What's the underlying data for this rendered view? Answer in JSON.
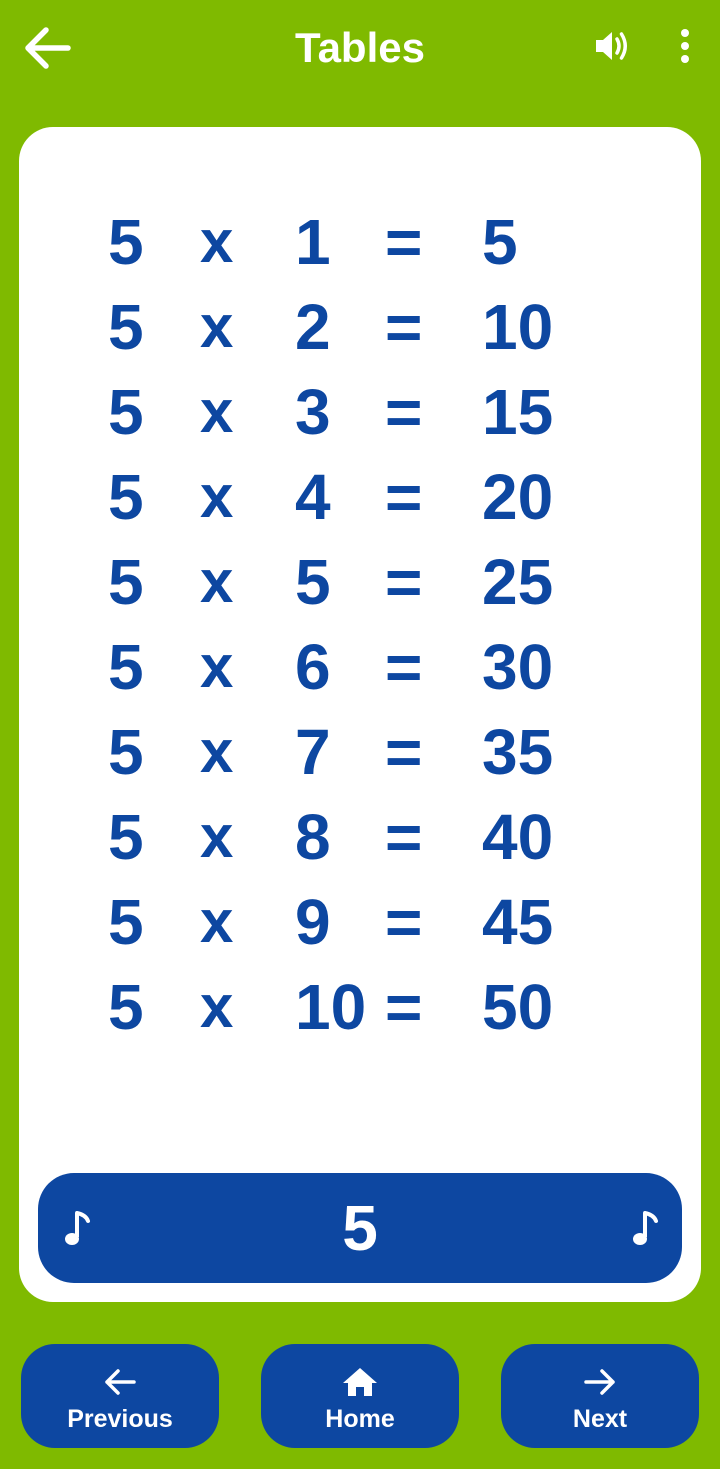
{
  "app_bar": {
    "title": "Tables",
    "back_icon": "arrow-left-icon",
    "sound_icon": "speaker-icon",
    "menu_icon": "more-vertical-icon"
  },
  "table": {
    "rows": [
      {
        "a": "5",
        "op": "x",
        "b": "1",
        "eq": "=",
        "result": "5"
      },
      {
        "a": "5",
        "op": "x",
        "b": "2",
        "eq": "=",
        "result": "10"
      },
      {
        "a": "5",
        "op": "x",
        "b": "3",
        "eq": "=",
        "result": "15"
      },
      {
        "a": "5",
        "op": "x",
        "b": "4",
        "eq": "=",
        "result": "20"
      },
      {
        "a": "5",
        "op": "x",
        "b": "5",
        "eq": "=",
        "result": "25"
      },
      {
        "a": "5",
        "op": "x",
        "b": "6",
        "eq": "=",
        "result": "30"
      },
      {
        "a": "5",
        "op": "x",
        "b": "7",
        "eq": "=",
        "result": "35"
      },
      {
        "a": "5",
        "op": "x",
        "b": "8",
        "eq": "=",
        "result": "40"
      },
      {
        "a": "5",
        "op": "x",
        "b": "9",
        "eq": "=",
        "result": "45"
      },
      {
        "a": "5",
        "op": "x",
        "b": "10",
        "eq": "=",
        "result": "50"
      }
    ]
  },
  "play_bar": {
    "number": "5",
    "left_icon": "music-note-icon",
    "right_icon": "music-note-icon"
  },
  "bottom_nav": {
    "previous_label": "Previous",
    "home_label": "Home",
    "next_label": "Next"
  },
  "colors": {
    "background": "#7FBA00",
    "card": "#FFFFFF",
    "primary_blue": "#0D47A1",
    "text_on_primary": "#FFFFFF"
  }
}
